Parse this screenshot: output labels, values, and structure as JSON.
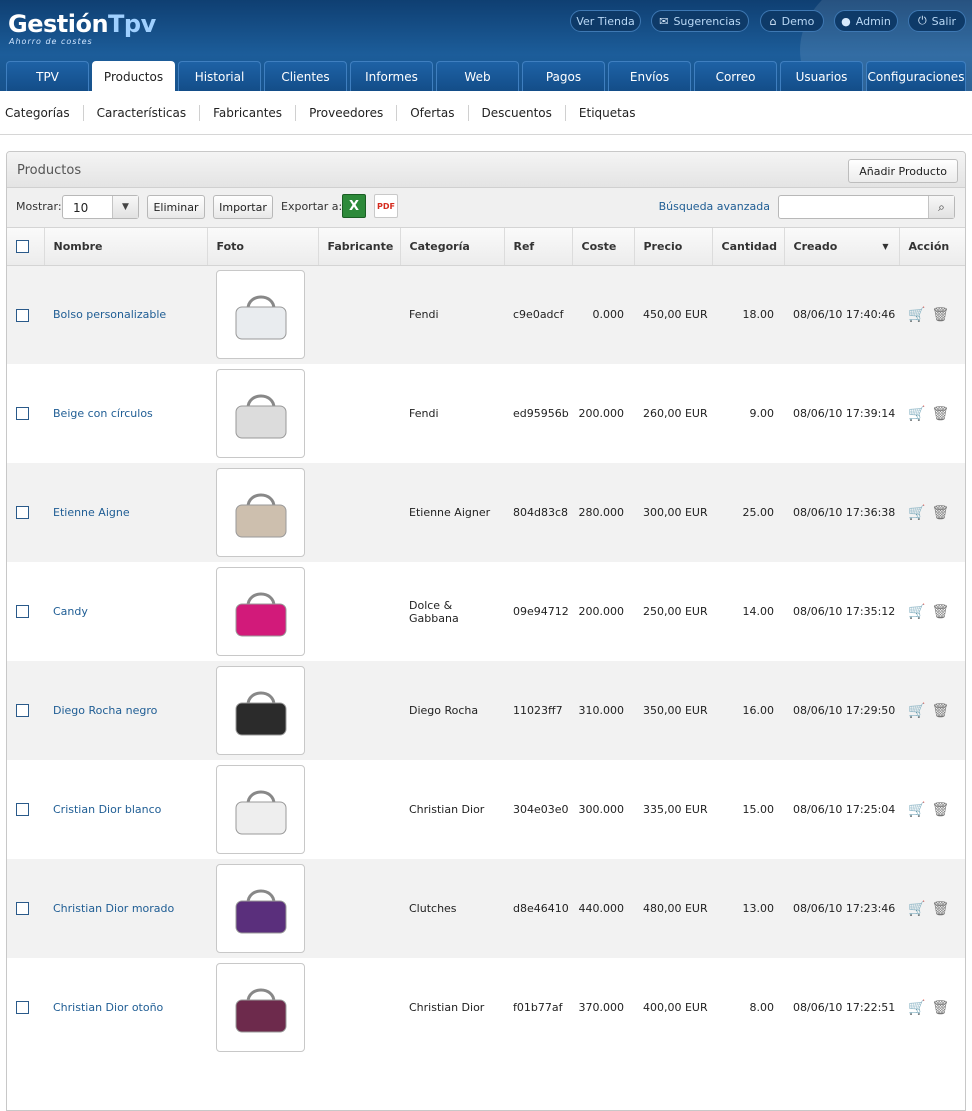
{
  "brand": {
    "name_main": "Gestión",
    "name_accent": "Tpv",
    "tagline": "Ahorro de costes"
  },
  "toplinks": [
    {
      "label": "Ver Tienda",
      "icon": ""
    },
    {
      "label": "Sugerencias",
      "icon": "envelope-icon"
    },
    {
      "label": "Demo",
      "icon": "home-icon"
    },
    {
      "label": "Admin",
      "icon": "user-icon"
    },
    {
      "label": "Salir",
      "icon": "power-icon"
    }
  ],
  "tabs": [
    "TPV",
    "Productos",
    "Historial",
    "Clientes",
    "Informes",
    "Web",
    "Pagos",
    "Envíos",
    "Correo",
    "Usuarios",
    "Configuraciones"
  ],
  "active_tab": "Productos",
  "subnav": [
    "Categorías",
    "Características",
    "Fabricantes",
    "Proveedores",
    "Ofertas",
    "Descuentos",
    "Etiquetas"
  ],
  "panel": {
    "title": "Productos",
    "add_button": "Añadir Producto",
    "show_label": "Mostrar:",
    "show_value": "10",
    "delete_button": "Eliminar",
    "import_button": "Importar",
    "export_label": "Exportar a:",
    "advanced_search": "Búsqueda avanzada",
    "search_value": ""
  },
  "table": {
    "columns": [
      "Nombre",
      "Foto",
      "Fabricante",
      "Categoría",
      "Ref",
      "Coste",
      "Precio",
      "Cantidad",
      "Creado",
      "Acción"
    ],
    "rows": [
      {
        "name": "Bolso personalizable",
        "fabricante": "",
        "categoria": "Fendi",
        "ref": "c9e0adcf",
        "coste": "0.000",
        "precio": "450,00 EUR",
        "cantidad": "18.00",
        "creado": "08/06/10 17:40:46",
        "color": "#e9ecef"
      },
      {
        "name": "Beige con círculos",
        "fabricante": "",
        "categoria": "Fendi",
        "ref": "ed95956b",
        "coste": "200.000",
        "precio": "260,00 EUR",
        "cantidad": "9.00",
        "creado": "08/06/10 17:39:14",
        "color": "#dcdcdc"
      },
      {
        "name": "Etienne Aigne",
        "fabricante": "",
        "categoria": "Etienne Aigner",
        "ref": "804d83c8",
        "coste": "280.000",
        "precio": "300,00 EUR",
        "cantidad": "25.00",
        "creado": "08/06/10 17:36:38",
        "color": "#cdbfae"
      },
      {
        "name": "Candy",
        "fabricante": "",
        "categoria": "Dolce & Gabbana",
        "ref": "09e94712",
        "coste": "200.000",
        "precio": "250,00 EUR",
        "cantidad": "14.00",
        "creado": "08/06/10 17:35:12",
        "color": "#d21a7a"
      },
      {
        "name": "Diego Rocha negro",
        "fabricante": "",
        "categoria": "Diego Rocha",
        "ref": "11023ff7",
        "coste": "310.000",
        "precio": "350,00 EUR",
        "cantidad": "16.00",
        "creado": "08/06/10 17:29:50",
        "color": "#2b2b2b"
      },
      {
        "name": "Cristian Dior blanco",
        "fabricante": "",
        "categoria": "Christian Dior",
        "ref": "304e03e0",
        "coste": "300.000",
        "precio": "335,00 EUR",
        "cantidad": "15.00",
        "creado": "08/06/10 17:25:04",
        "color": "#eeeeee"
      },
      {
        "name": "Christian Dior morado",
        "fabricante": "",
        "categoria": "Clutches",
        "ref": "d8e46410",
        "coste": "440.000",
        "precio": "480,00 EUR",
        "cantidad": "13.00",
        "creado": "08/06/10 17:23:46",
        "color": "#5a2f7c"
      },
      {
        "name": "Christian Dior otoño",
        "fabricante": "",
        "categoria": "Christian Dior",
        "ref": "f01b77af",
        "coste": "370.000",
        "precio": "400,00 EUR",
        "cantidad": "8.00",
        "creado": "08/06/10 17:22:51",
        "color": "#6d2a4c"
      }
    ]
  },
  "icons": {
    "cart": "cart-icon",
    "trash": "trash-icon"
  }
}
